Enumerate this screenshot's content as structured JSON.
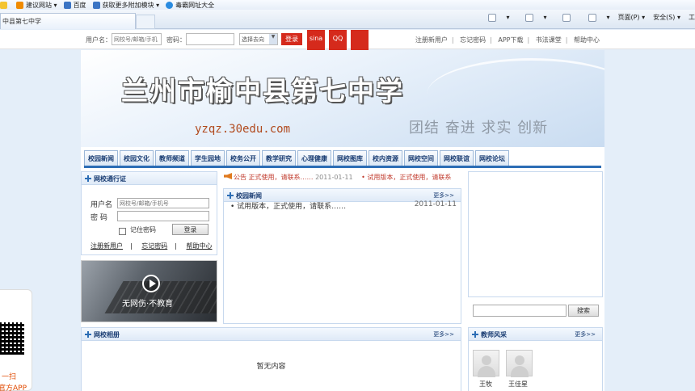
{
  "browser": {
    "favorites": [
      "建议网站 ▾",
      "百度",
      "获取更多附加模块 ▾",
      "毒霸网址大全"
    ],
    "tab_title": "中县第七中学",
    "commands": [
      "▾",
      "▾",
      "▾",
      "页面(P) ▾",
      "安全(S) ▾",
      "工"
    ]
  },
  "sitebar": {
    "username_label": "用户名：",
    "username_placeholder": "网校号/邮箱/手机",
    "password_label": "密码：",
    "select_value": "选择去向",
    "login_button": "登录",
    "sina_button": "sina",
    "qq_button": "QQ",
    "links": [
      "注册新用户",
      "忘记密码",
      "APP下载",
      "书法课堂",
      "帮助中心"
    ]
  },
  "qr_ad": {
    "line1": "一扫",
    "line2": "官方APP"
  },
  "banner": {
    "title": "兰州市榆中县第七中学",
    "domain": "yzqz.30edu.com",
    "slogan": "团结 奋进 求实 创新"
  },
  "nav": [
    "校园新闻",
    "校园文化",
    "教师频道",
    "学生园地",
    "校务公开",
    "教学研究",
    "心理健康",
    "网校图库",
    "校内资源",
    "网校空间",
    "网校联谊",
    "网校论坛"
  ],
  "login_panel": {
    "title": "网校通行证",
    "username_label": "用户名",
    "username_placeholder": "网校号/邮箱/手机号",
    "password_label": "密 码",
    "remember_label": "记住密码",
    "login_button": "登录",
    "links": [
      "注册新用户",
      "忘记密码",
      "帮助中心"
    ]
  },
  "video": {
    "caption": "无网伤·不教育"
  },
  "ticker": {
    "label": "公告",
    "item1": "正式使用，请联系……",
    "date1": "2011-01-11",
    "item2": "• 试用版本，正式使用，请联系"
  },
  "news_panel": {
    "title": "校园新闻",
    "more": "更多>>",
    "items": [
      {
        "text": "• 试用版本，正式使用，请联系……",
        "date": "2011-01-11"
      }
    ]
  },
  "search": {
    "button": "搜索"
  },
  "album_panel": {
    "title": "网校相册",
    "more": "更多>>",
    "empty": "暂无内容"
  },
  "teacher_panel": {
    "title": "教师风采",
    "more": "更多>>",
    "teachers": [
      {
        "name": "王牧"
      },
      {
        "name": "王佳星"
      }
    ]
  }
}
